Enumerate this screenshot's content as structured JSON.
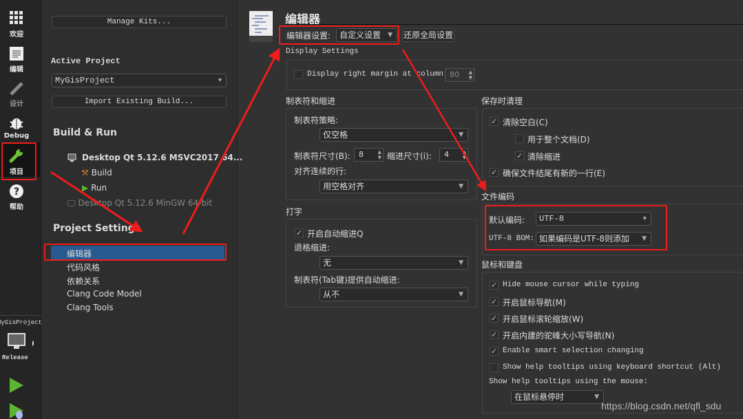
{
  "sidebar": {
    "items": [
      {
        "label": "欢迎",
        "icon": "grid-icon"
      },
      {
        "label": "编辑",
        "icon": "document-icon"
      },
      {
        "label": "设计",
        "icon": "pencil-icon"
      },
      {
        "label": "Debug",
        "icon": "bug-icon"
      },
      {
        "label": "项目",
        "icon": "wrench-icon",
        "active": true
      },
      {
        "label": "帮助",
        "icon": "help-icon"
      }
    ],
    "target_project": "MyGisProject",
    "build_config": "Release"
  },
  "project_pane": {
    "manage_kits": "Manage Kits...",
    "active_project_heading": "Active Project",
    "active_project": "MyGisProject",
    "import_build": "Import Existing Build...",
    "build_run_heading": "Build & Run",
    "kits": [
      {
        "name": "Desktop Qt 5.12.6 MSVC2017 64...",
        "build": "Build",
        "run": "Run"
      },
      {
        "name": "Desktop Qt 5.12.6 MinGW 64-bit"
      }
    ],
    "project_settings_heading": "Project Settings",
    "settings_items": [
      "编辑器",
      "代码风格",
      "依赖关系",
      "Clang Code Model",
      "Clang Tools"
    ],
    "selected": "编辑器"
  },
  "editor": {
    "title": "编辑器",
    "settings_label": "编辑器设置:",
    "settings_value": "自定义设置",
    "restore_button": "还原全局设置",
    "display": {
      "heading": "Display Settings",
      "right_margin_label": "Display right margin at column:",
      "right_margin_checked": false,
      "right_margin_value": "80"
    },
    "tabs": {
      "heading": "制表符和缩进",
      "policy_label": "制表符策略:",
      "policy_value": "仅空格",
      "tab_size_label": "制表符尺寸(B):",
      "tab_size": "8",
      "indent_size_label": "缩进尺寸(i):",
      "indent_size": "4",
      "align_label": "对齐连续的行:",
      "align_value": "用空格对齐"
    },
    "typing": {
      "heading": "打字",
      "auto_indent": "开启自动缩进Q",
      "backspace_label": "退格缩进:",
      "backspace_value": "无",
      "tab_auto_label": "制表符(Tab键)提供自动缩进:",
      "tab_auto_value": "从不"
    },
    "cleanup": {
      "heading": "保存时清理",
      "items": [
        {
          "label": "清除空白(C)",
          "checked": true
        },
        {
          "label": "用于整个文档(D)",
          "checked": false
        },
        {
          "label": "清除缩进",
          "checked": true
        },
        {
          "label": "确保文件结尾有新的一行(E)",
          "checked": true
        }
      ]
    },
    "encoding": {
      "heading": "文件编码",
      "default_label": "默认编码:",
      "default_value": "UTF-8",
      "bom_label": "UTF-8 BOM:",
      "bom_value": "如果编码是UTF-8则添加"
    },
    "mouse": {
      "heading": "鼠标和键盘",
      "items": [
        {
          "label": "Hide mouse cursor while typing",
          "checked": true
        },
        {
          "label": "开启鼠标导航(M)",
          "checked": true
        },
        {
          "label": "开启鼠标滚轮缩放(W)",
          "checked": true
        },
        {
          "label": "开启内建的驼峰大小写导航(N)",
          "checked": true
        },
        {
          "label": "Enable smart selection changing",
          "checked": true
        },
        {
          "label": "Show help tooltips using keyboard shortcut (Alt)",
          "checked": false
        }
      ],
      "tooltip_label": "Show help tooltips using the mouse:",
      "tooltip_value": "在鼠标悬停时"
    }
  },
  "watermark": "https://blog.csdn.net/qfl_sdu",
  "colors": {
    "selection": "#265a91",
    "annotation": "#f01c1c",
    "run_green": "#5cb531"
  }
}
